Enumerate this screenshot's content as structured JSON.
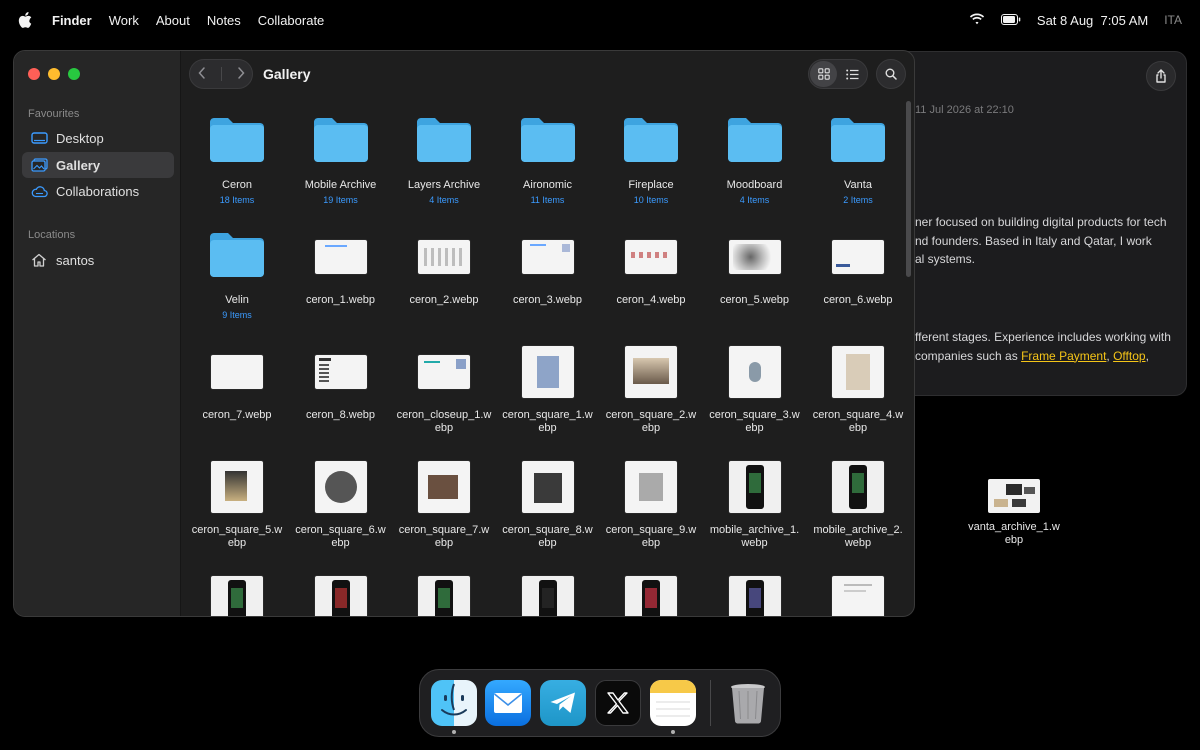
{
  "menubar": {
    "app_name": "Finder",
    "items": [
      "Work",
      "About",
      "Notes",
      "Collaborate"
    ],
    "datetime": "Sat 8 Aug  7:05 AM",
    "language": "ITA"
  },
  "notes_window": {
    "date": "11 Jul 2026 at 22:10",
    "paragraph1": [
      "ner focused on building digital products for tech",
      "nd founders. Based in Italy and Qatar, I work",
      "al systems."
    ],
    "paragraph2_line1": "fferent stages. Experience includes working with",
    "paragraph2_line2_prefix": "companies such as ",
    "link1": "Frame Payment",
    "link_sep": ", ",
    "link2": "Offtop",
    "link_suffix": ","
  },
  "finder": {
    "title": "Gallery",
    "sidebar": {
      "favourites_label": "Favourites",
      "favourites": [
        {
          "label": "Desktop",
          "icon": "desktop-icon"
        },
        {
          "label": "Gallery",
          "icon": "gallery-icon",
          "active": true
        },
        {
          "label": "Collaborations",
          "icon": "cloud-icon"
        }
      ],
      "locations_label": "Locations",
      "locations": [
        {
          "label": "santos",
          "icon": "home-icon"
        }
      ]
    },
    "items": [
      {
        "name": "Ceron",
        "count": "18 Items",
        "kind": "folder"
      },
      {
        "name": "Mobile Archive",
        "count": "19 Items",
        "kind": "folder"
      },
      {
        "name": "Layers Archive",
        "count": "4 Items",
        "kind": "folder"
      },
      {
        "name": "Aironomic",
        "count": "11 Items",
        "kind": "folder"
      },
      {
        "name": "Fireplace",
        "count": "10 Items",
        "kind": "folder"
      },
      {
        "name": "Moodboard",
        "count": "4 Items",
        "kind": "folder"
      },
      {
        "name": "Vanta",
        "count": "2 Items",
        "kind": "folder"
      },
      {
        "name": "Velin",
        "count": "9 Items",
        "kind": "folder"
      },
      {
        "name": "ceron_1.webp",
        "kind": "wide"
      },
      {
        "name": "ceron_2.webp",
        "kind": "wide"
      },
      {
        "name": "ceron_3.webp",
        "kind": "wide"
      },
      {
        "name": "ceron_4.webp",
        "kind": "wide"
      },
      {
        "name": "ceron_5.webp",
        "kind": "wide"
      },
      {
        "name": "ceron_6.webp",
        "kind": "wide"
      },
      {
        "name": "ceron_7.webp",
        "kind": "wide"
      },
      {
        "name": "ceron_8.webp",
        "kind": "wide"
      },
      {
        "name": "ceron_closeup_1.webp",
        "kind": "wide"
      },
      {
        "name": "ceron_square_1.webp",
        "kind": "sq"
      },
      {
        "name": "ceron_square_2.webp",
        "kind": "sq"
      },
      {
        "name": "ceron_square_3.webp",
        "kind": "sq"
      },
      {
        "name": "ceron_square_4.webp",
        "kind": "sq"
      },
      {
        "name": "ceron_square_5.webp",
        "kind": "sq"
      },
      {
        "name": "ceron_square_6.webp",
        "kind": "sq"
      },
      {
        "name": "ceron_square_7.webp",
        "kind": "sq"
      },
      {
        "name": "ceron_square_8.webp",
        "kind": "sq"
      },
      {
        "name": "ceron_square_9.webp",
        "kind": "sq"
      },
      {
        "name": "mobile_archive_1.webp",
        "kind": "phone"
      },
      {
        "name": "mobile_archive_2.webp",
        "kind": "phone"
      },
      {
        "name": "",
        "kind": "phone"
      },
      {
        "name": "",
        "kind": "phone"
      },
      {
        "name": "",
        "kind": "phone"
      },
      {
        "name": "",
        "kind": "phone"
      },
      {
        "name": "",
        "kind": "phone"
      },
      {
        "name": "",
        "kind": "phone"
      },
      {
        "name": "",
        "kind": "doc"
      }
    ]
  },
  "desktop": {
    "file_name": "vanta_archive_1.webp"
  },
  "dock": {
    "apps": [
      {
        "name": "Finder",
        "icon": "finder-icon",
        "running": true
      },
      {
        "name": "Mail",
        "icon": "mail-icon",
        "running": false
      },
      {
        "name": "Telegram",
        "icon": "telegram-icon",
        "running": false
      },
      {
        "name": "X",
        "icon": "x-icon",
        "running": false
      },
      {
        "name": "Notes",
        "icon": "notes-icon",
        "running": true
      },
      {
        "name": "Trash",
        "icon": "trash-icon",
        "running": false
      }
    ]
  },
  "colors": {
    "accent": "#3b9bff",
    "folder": "#4fb4ef",
    "link": "#f5c518"
  }
}
